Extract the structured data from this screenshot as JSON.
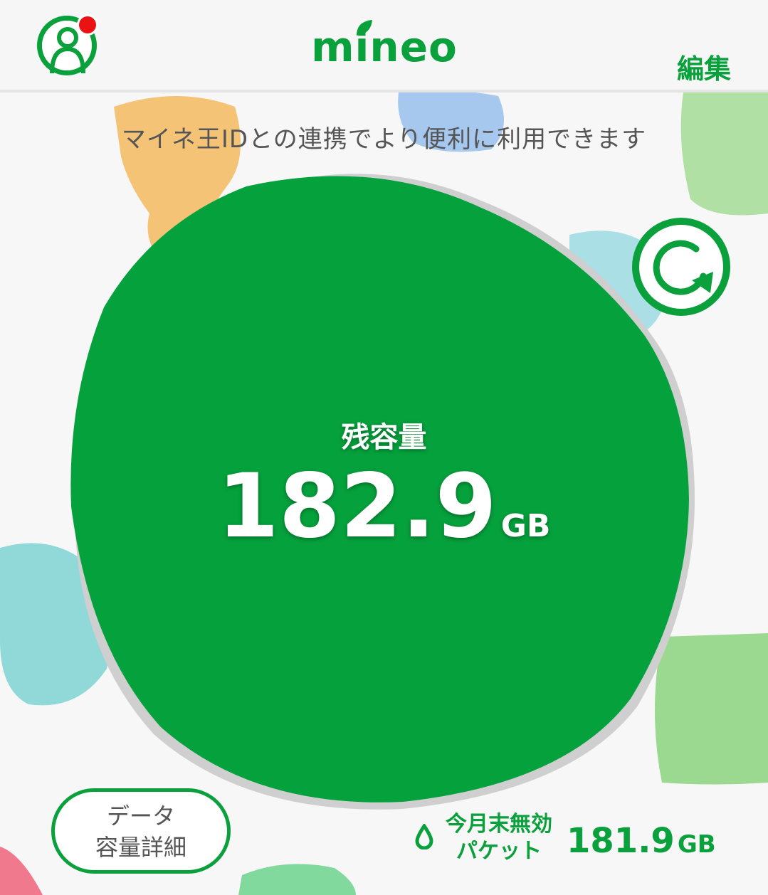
{
  "header": {
    "logo": "mineo",
    "edit_label": "編集"
  },
  "banner_text": "マイネ王IDとの連携でより便利に利用できます",
  "remaining": {
    "label": "残容量",
    "value": "182.9",
    "unit": "GB"
  },
  "detail_button": {
    "line1": "データ",
    "line2": "容量詳細"
  },
  "expiring": {
    "label_line1": "今月末無効",
    "label_line2": "パケット",
    "value": "181.9",
    "unit": "GB"
  },
  "colors": {
    "brand_green": "#0aa03c",
    "notification": "#ea1212"
  },
  "icons": [
    "user-icon",
    "notification-dot",
    "refresh-icon",
    "drop-icon"
  ]
}
